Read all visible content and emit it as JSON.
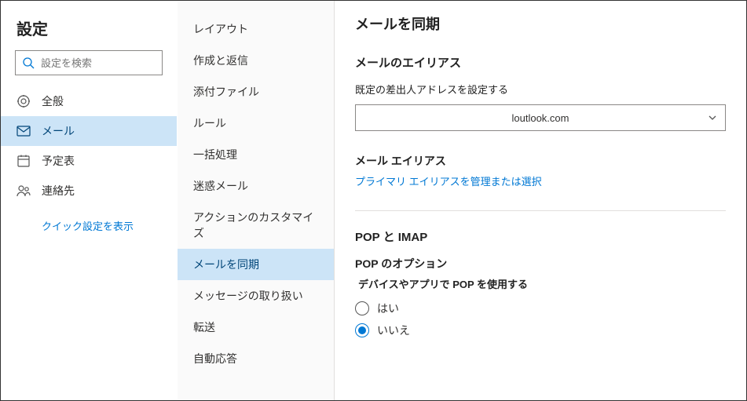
{
  "page_title": "設定",
  "search": {
    "placeholder": "設定を検索"
  },
  "nav": [
    {
      "key": "general",
      "label": "全般",
      "icon": "gear-icon"
    },
    {
      "key": "mail",
      "label": "メール",
      "icon": "mail-icon",
      "active": true
    },
    {
      "key": "calendar",
      "label": "予定表",
      "icon": "calendar-icon"
    },
    {
      "key": "people",
      "label": "連絡先",
      "icon": "people-icon"
    }
  ],
  "quick_settings_link": "クイック設定を表示",
  "subnav": [
    {
      "key": "layout",
      "label": "レイアウト"
    },
    {
      "key": "compose",
      "label": "作成と返信"
    },
    {
      "key": "attach",
      "label": "添付ファイル"
    },
    {
      "key": "rules",
      "label": "ルール"
    },
    {
      "key": "sweep",
      "label": "一括処理"
    },
    {
      "key": "junk",
      "label": "迷惑メール"
    },
    {
      "key": "actions",
      "label": "アクションのカスタマイズ"
    },
    {
      "key": "sync",
      "label": "メールを同期",
      "active": true
    },
    {
      "key": "handling",
      "label": "メッセージの取り扱い"
    },
    {
      "key": "forward",
      "label": "転送"
    },
    {
      "key": "autorep",
      "label": "自動応答"
    }
  ],
  "content": {
    "title": "メールを同期",
    "alias": {
      "heading": "メールのエイリアス",
      "default_from_label": "既定の差出人アドレスを設定する",
      "dropdown_value": "loutlook.com",
      "alias_label": "メール エイリアス",
      "manage_link": "プライマリ エイリアスを管理または選択"
    },
    "pop_imap": {
      "heading": "POP と IMAP",
      "pop_option_label": "POP のオプション",
      "pop_enable_label": "デバイスやアプリで POP を使用する",
      "radio_yes": "はい",
      "radio_no": "いいえ",
      "selected": "no"
    }
  }
}
